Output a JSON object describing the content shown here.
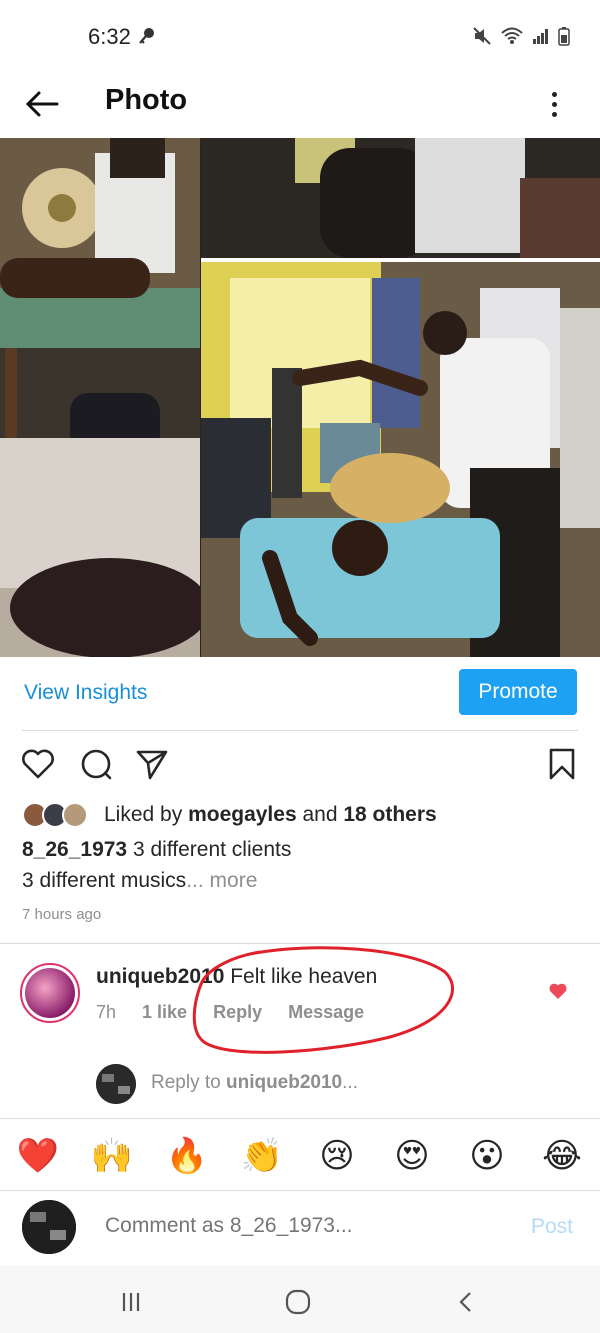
{
  "status_bar": {
    "time": "6:32"
  },
  "app_bar": {
    "title": "Photo"
  },
  "insights": {
    "view_insights": "View Insights",
    "promote": "Promote"
  },
  "likes": {
    "prefix": "Liked by ",
    "user": "moegayles",
    "middle": " and ",
    "others": "18 others"
  },
  "caption": {
    "username": "8_26_1973",
    "line1": " 3 different clients",
    "line2": "3 different musics",
    "more": "... more"
  },
  "posted": "7 hours ago",
  "comment": {
    "username": "uniqueb2010",
    "text": " Felt like heaven",
    "time": "7h",
    "likes": "1 like",
    "reply": "Reply",
    "message": "Message"
  },
  "reply_prompt": {
    "prefix": "Reply to ",
    "username": "uniqueb2010",
    "suffix": "..."
  },
  "emojis": [
    "❤️",
    "🙌",
    "🔥",
    "👏",
    "😢",
    "😍",
    "😮",
    "😂"
  ],
  "composer": {
    "placeholder": "Comment as 8_26_1973...",
    "post": "Post"
  },
  "colors": {
    "accent": "#1da1f2",
    "link": "#1a8fd6",
    "heart": "#ed4956",
    "annotation": "#e0202a"
  }
}
